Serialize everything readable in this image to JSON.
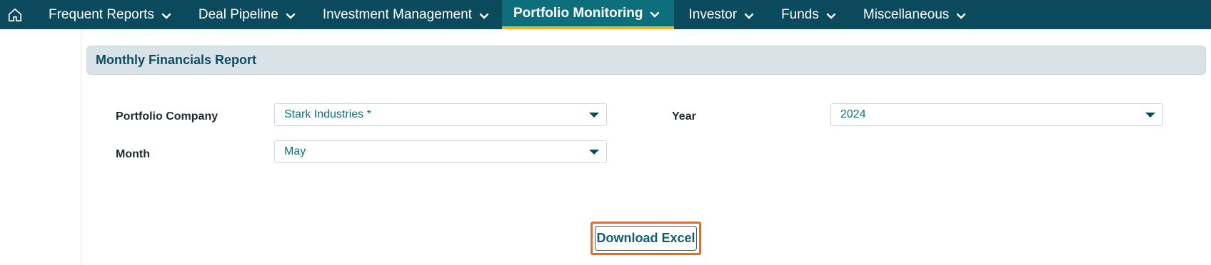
{
  "nav": {
    "home_icon": "home-icon",
    "items": [
      {
        "label": "Frequent Reports"
      },
      {
        "label": "Deal Pipeline"
      },
      {
        "label": "Investment Management"
      },
      {
        "label": "Portfolio Monitoring",
        "active": true
      },
      {
        "label": "Investor"
      },
      {
        "label": "Funds"
      },
      {
        "label": "Miscellaneous"
      }
    ],
    "colors": {
      "bar": "#0b4a5c",
      "active": "#0e6f7c",
      "active_underline": "#f3b41b"
    }
  },
  "report": {
    "title": "Monthly Financials Report",
    "fields": {
      "portfolio_company": {
        "label": "Portfolio Company",
        "value": "Stark Industries *"
      },
      "year": {
        "label": "Year",
        "value": "2024"
      },
      "month": {
        "label": "Month",
        "value": "May"
      }
    },
    "download_label": "Download Excel",
    "colors": {
      "highlight": "#ee6a1a",
      "value_text": "#0e6f7c"
    }
  }
}
